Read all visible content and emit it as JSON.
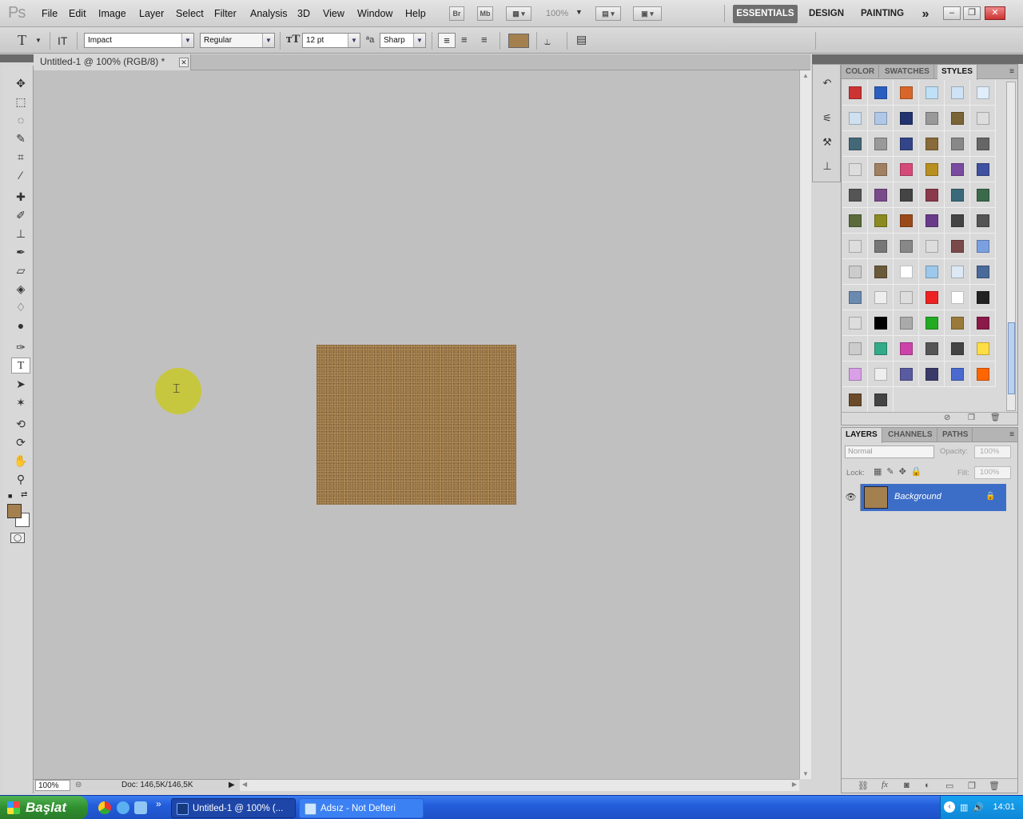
{
  "app": {
    "logo": "Ps"
  },
  "menu": [
    "File",
    "Edit",
    "Image",
    "Layer",
    "Select",
    "Filter",
    "Analysis",
    "3D",
    "View",
    "Window",
    "Help"
  ],
  "appbar": {
    "bridge": "Br",
    "minibridge": "Mb",
    "zoom": "100%"
  },
  "workspaces": {
    "essentials": "ESSENTIALS",
    "design": "DESIGN",
    "painting": "PAINTING",
    "more": "»"
  },
  "window_controls": {
    "minimize": "–",
    "restore": "❐",
    "close": "✕"
  },
  "options": {
    "tool_glyph": "T",
    "font_family": "Impact",
    "font_style": "Regular",
    "font_size": "12 pt",
    "antialias": "Sharp",
    "text_color": "#a5804f"
  },
  "document": {
    "tab_title": "Untitled-1 @ 100% (RGB/8) *",
    "tab_close": "✕",
    "fill_color": "#a5804f",
    "zoom_field": "100%",
    "doc_size": "Doc: 146,5K/146,5K"
  },
  "tools": {
    "foreground": "#a5804f",
    "background": "#ffffff"
  },
  "styles_panel": {
    "tabs": [
      "COLOR",
      "SWATCHES",
      "STYLES"
    ],
    "active_tab": "STYLES"
  },
  "layers_panel": {
    "tabs": [
      "LAYERS",
      "CHANNELS",
      "PATHS"
    ],
    "active_tab": "LAYERS",
    "blend_mode": "Normal",
    "opacity_label": "Opacity:",
    "opacity": "100%",
    "lock_label": "Lock:",
    "fill_label": "Fill:",
    "fill": "100%",
    "layer_name": "Background"
  },
  "taskbar": {
    "start": "Başlat",
    "tasks": [
      "Untitled-1 @ 100% (...",
      "Adsız - Not Defteri"
    ],
    "clock": "14:01",
    "quick_more": "»"
  }
}
